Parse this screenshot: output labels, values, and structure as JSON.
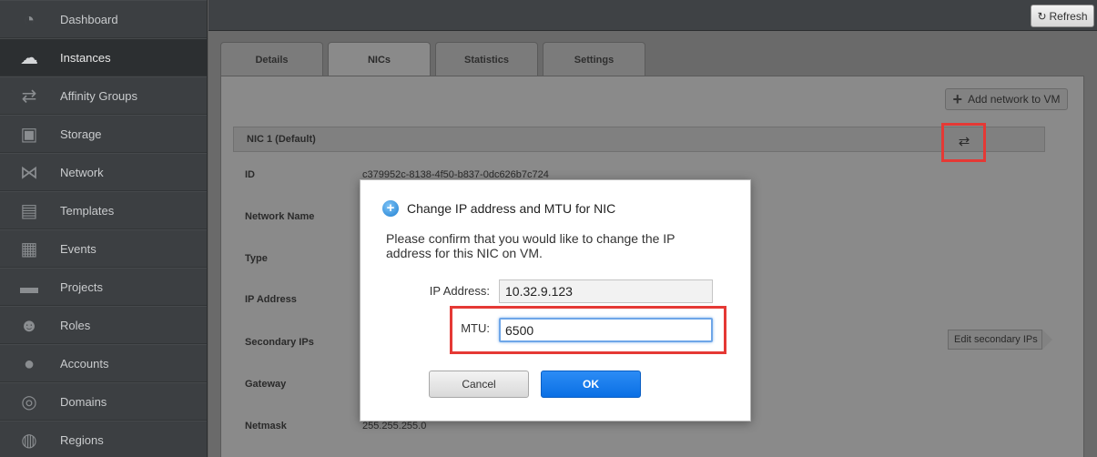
{
  "sidebar": {
    "items": [
      {
        "label": "Dashboard",
        "icon": "dashboard-icon",
        "glyph": "◔"
      },
      {
        "label": "Instances",
        "icon": "cloud-icon",
        "glyph": "☁"
      },
      {
        "label": "Affinity Groups",
        "icon": "affinity-icon",
        "glyph": "⇄"
      },
      {
        "label": "Storage",
        "icon": "storage-icon",
        "glyph": "▣"
      },
      {
        "label": "Network",
        "icon": "network-icon",
        "glyph": "⋈"
      },
      {
        "label": "Templates",
        "icon": "templates-icon",
        "glyph": "▤"
      },
      {
        "label": "Events",
        "icon": "calendar-icon",
        "glyph": "▦"
      },
      {
        "label": "Projects",
        "icon": "folder-icon",
        "glyph": "▬"
      },
      {
        "label": "Roles",
        "icon": "roles-icon",
        "glyph": "☻"
      },
      {
        "label": "Accounts",
        "icon": "user-icon",
        "glyph": "●"
      },
      {
        "label": "Domains",
        "icon": "domains-icon",
        "glyph": "◎"
      },
      {
        "label": "Regions",
        "icon": "globe-icon",
        "glyph": "◍"
      }
    ],
    "active_index": 1
  },
  "topbar": {
    "refresh_label": "Refresh",
    "refresh_glyph": "↻"
  },
  "tabs": [
    {
      "label": "Details"
    },
    {
      "label": "NICs"
    },
    {
      "label": "Statistics"
    },
    {
      "label": "Settings"
    }
  ],
  "nic": {
    "add_network_label": "Add network to VM",
    "header": "NIC 1 (Default)",
    "swap_glyph": "⇄",
    "edit_secondary_label": "Edit secondary IPs",
    "fields": [
      {
        "label": "ID",
        "value": "c379952c-8138-4f50-b837-0dc626b7c724"
      },
      {
        "label": "Network Name",
        "value": ""
      },
      {
        "label": "Type",
        "value": ""
      },
      {
        "label": "IP Address",
        "value": ""
      },
      {
        "label": "Secondary IPs",
        "value": ""
      },
      {
        "label": "Gateway",
        "value": ""
      },
      {
        "label": "Netmask",
        "value": "255.255.255.0"
      }
    ]
  },
  "dialog": {
    "title": "Change IP address and MTU for NIC",
    "message": "Please confirm that you would like to change the IP address for this NIC on VM.",
    "ip_label": "IP Address:",
    "ip_value": "10.32.9.123",
    "mtu_label": "MTU:",
    "mtu_value": "6500",
    "cancel_label": "Cancel",
    "ok_label": "OK"
  },
  "colors": {
    "highlight": "#e53935",
    "ok_button": "#0a6fe4",
    "info_icon": "#1f7fd1"
  }
}
